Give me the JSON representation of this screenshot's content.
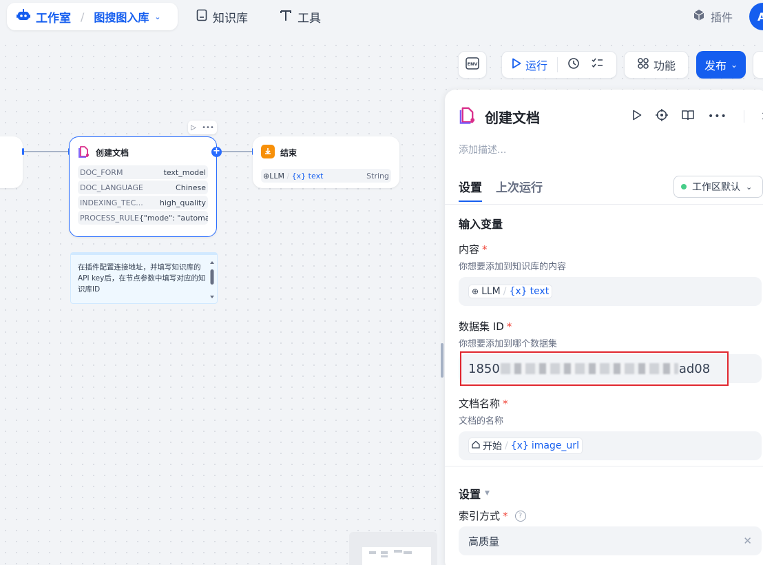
{
  "nav": {
    "studio_label": "工作室",
    "app_name": "图搜图入库",
    "knowledge_label": "知识库",
    "tools_label": "工具",
    "plugins_label": "插件",
    "avatar_letter": "A"
  },
  "toolbar": {
    "env_label": "ENV",
    "run_label": "运行",
    "features_label": "功能",
    "publish_label": "发布"
  },
  "canvas": {
    "create_node": {
      "title": "创建文档",
      "params": [
        {
          "key": "DOC_FORM",
          "value": "text_model"
        },
        {
          "key": "DOC_LANGUAGE",
          "value": "Chinese"
        },
        {
          "key": "INDEXING_TEC...",
          "value": "high_quality"
        },
        {
          "key": "PROCESS_RULE",
          "value": "{\"mode\": \"automa..."
        }
      ]
    },
    "end_node": {
      "title": "结束",
      "var_source": "LLM",
      "var_name": "{x} text",
      "var_type": "String"
    },
    "note": "在插件配置连接地址，并填写知识库的API key后，在节点参数中填写对应的知识库ID"
  },
  "panel": {
    "title": "创建文档",
    "description_placeholder": "添加描述...",
    "tabs": [
      "设置",
      "上次运行"
    ],
    "workspace_select": "工作区默认",
    "input_section": "输入变量",
    "fields": {
      "content": {
        "label": "内容",
        "desc": "你想要添加到知识库的内容",
        "var_source": "LLM",
        "var_name": "text"
      },
      "dataset_id": {
        "label": "数据集 ID",
        "desc": "你想要添加到哪个数据集",
        "value_prefix": "1850",
        "value_suffix": "ad08"
      },
      "doc_name": {
        "label": "文档名称",
        "desc": "文档的名称",
        "var_source": "开始",
        "var_name": "image_url"
      }
    },
    "settings_section": "设置",
    "index_method": {
      "label": "索引方式",
      "value": "高质量"
    }
  },
  "colors": {
    "accent": "#155eef",
    "required": "#f04438",
    "highlight": "#e0262e"
  }
}
